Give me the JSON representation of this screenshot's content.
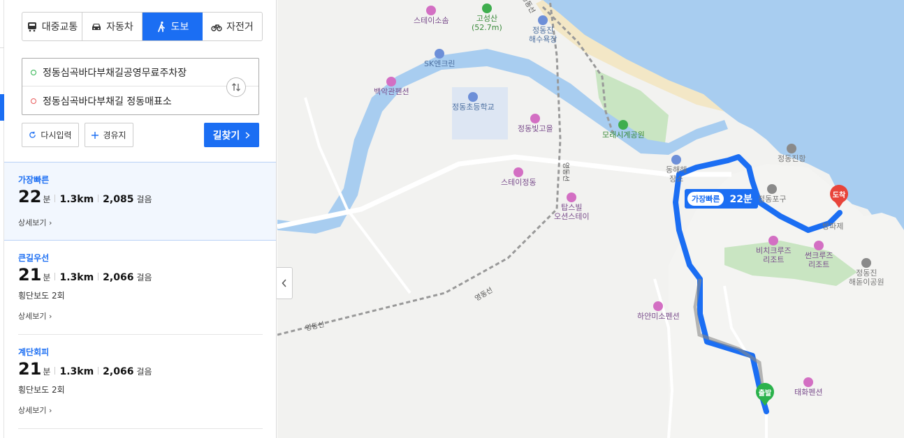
{
  "modes": [
    {
      "label": "대중교통",
      "icon": "bus-icon",
      "active": false
    },
    {
      "label": "자동차",
      "icon": "car-icon",
      "active": false
    },
    {
      "label": "도보",
      "icon": "walk-icon",
      "active": true
    },
    {
      "label": "자전거",
      "icon": "bicycle-icon",
      "active": false
    }
  ],
  "route": {
    "origin": "정동심곡바다부채길공영무료주차장",
    "destination": "정동심곡바다부채길 정동매표소"
  },
  "buttons": {
    "reset": "다시입력",
    "via": "경유지",
    "go": "길찾기"
  },
  "results": [
    {
      "title": "가장빠른",
      "minutes": "22",
      "min_unit": "분",
      "distance": "1.3km",
      "steps": "2,085",
      "step_unit": "걸음",
      "sub": "",
      "detail": "상세보기",
      "selected": true
    },
    {
      "title": "큰길우선",
      "minutes": "21",
      "min_unit": "분",
      "distance": "1.3km",
      "steps": "2,066",
      "step_unit": "걸음",
      "sub": "횡단보도 2회",
      "detail": "상세보기",
      "selected": false
    },
    {
      "title": "계단회피",
      "minutes": "21",
      "min_unit": "분",
      "distance": "1.3km",
      "steps": "2,066",
      "step_unit": "걸음",
      "sub": "횡단보도 2회",
      "detail": "상세보기",
      "selected": false
    }
  ],
  "map": {
    "route_tag": {
      "label": "가장빠른",
      "time": "22분"
    },
    "markers": {
      "end": "도착",
      "start": "출발"
    },
    "labels": {
      "stay_isoseum": "스테이소솜",
      "goseongsan": "고성산",
      "goseongsan_height": "(52.7m)",
      "jeongdongjin_beach_1": "정동진",
      "jeongdongjin_beach_2": "해수욕장",
      "sk_station": "SK엔크린",
      "baekak_pension": "백악관펜션",
      "jeongdong_school": "정동초등학교",
      "jeongdong_village": "정동빛고을",
      "sand_clock_park": "모래시계공원",
      "stay_jeongdong": "스테이정동",
      "tapsvill_1": "탑스빌",
      "tapsvill_2": "오션스테이",
      "donghae_1": "동해해",
      "donghae_2": "장소",
      "jeongdong_port": "정동진항",
      "jeongdong_pogu": "정동포구",
      "breakwater": "방파제",
      "beach_cruise_1": "비치크루즈",
      "beach_cruise_2": "리조트",
      "suncruise_1": "썬크루즈",
      "suncruise_2": "리조트",
      "haedoji_park_1": "정동진",
      "haedoji_park_2": "해돋이공원",
      "hayan_pension": "하얀미소펜션",
      "taehwa_pension": "태화펜션",
      "yeongdong_line_1": "영동선",
      "yeongdong_line_2": "영동선",
      "yeongdong_line_3": "영동선",
      "yeongdong_line_4": "영동선"
    }
  },
  "colors": {
    "accent": "#1b6ef3",
    "sea": "#a8cdf0",
    "river": "#a8cdf0",
    "park": "#c9e5c2",
    "route": "#1b6ef3"
  }
}
